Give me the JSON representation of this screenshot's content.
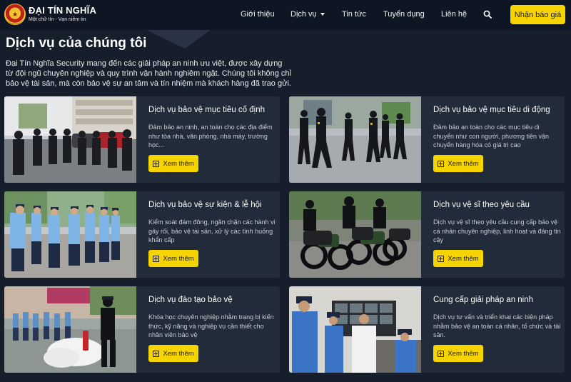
{
  "header": {
    "logo": {
      "title": "ĐẠI TÍN NGHĨA",
      "tagline": "Một chữ tín - Vạn niềm tin"
    },
    "nav": [
      {
        "label": "Giới thiệu"
      },
      {
        "label": "Dịch vụ"
      },
      {
        "label": "Tin tức"
      },
      {
        "label": "Tuyển dụng"
      },
      {
        "label": "Liên hệ"
      }
    ],
    "cta_label": "Nhận báo giá"
  },
  "section": {
    "title": "Dịch vụ của chúng tôi",
    "intro": "Đại Tín Nghĩa Security mang đến các giải pháp an ninh ưu việt, được xây dựng từ đội ngũ chuyên nghiệp và quy trình vận hành nghiêm ngặt. Chúng tôi không chỉ bảo vệ tài sản, mà còn bảo vệ sự an tâm và tín nhiệm mà khách hàng đã trao gửi."
  },
  "services": [
    {
      "title": "Dịch vụ bảo vệ mục tiêu cố định",
      "desc": "Đảm bảo an ninh, an toàn cho các địa điểm như tòa nhà, văn phòng, nhà máy, trường học...",
      "button": "Xem thêm"
    },
    {
      "title": "Dịch vụ bảo vệ mục tiêu di động",
      "desc": "Đảm bảo an toàn cho các mục tiêu di chuyển như con người, phương tiện vận chuyển hàng hóa có giá trị cao",
      "button": "Xem thêm"
    },
    {
      "title": "Dịch vụ bảo vệ sự kiện & lễ hội",
      "desc": "Kiểm soát đám đông, ngăn chặn các hành vi gây rối, bảo vệ tài sản, xử lý các tình huống khẩn cấp",
      "button": "Xem thêm"
    },
    {
      "title": "Dịch vụ vệ sĩ theo yêu cầu",
      "desc": "Dịch vụ vệ sĩ theo yêu cầu cung cấp bảo vệ cá nhân chuyên nghiệp, linh hoạt và đáng tin cậy",
      "button": "Xem thêm"
    },
    {
      "title": "Dịch vụ đào tạo bảo vệ",
      "desc": "Khóa học chuyên nghiệp nhằm trang bị kiến thức, kỹ năng và nghiệp vụ cần thiết cho nhân viên bảo vệ",
      "button": "Xem thêm"
    },
    {
      "title": "Cung cấp giải pháp an ninh",
      "desc": "Dịch vụ tư vấn và triển khai các biện pháp nhằm bảo vệ an toàn cá nhân, tổ chức và tài sản.",
      "button": "Xem thêm"
    }
  ],
  "colors": {
    "accent": "#f5d400",
    "background": "#161e2c",
    "card": "#222b3a",
    "header": "#0f1623"
  }
}
